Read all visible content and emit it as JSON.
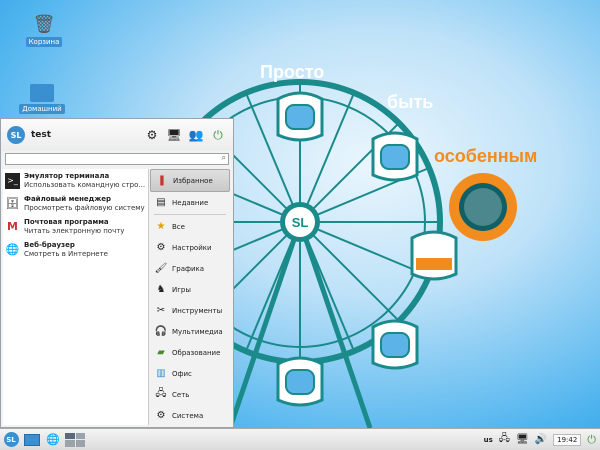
{
  "desktop": {
    "icons": [
      {
        "label": "Корзина",
        "icon": "trash-icon"
      },
      {
        "label": "Домашний",
        "icon": "home-folder-icon"
      }
    ],
    "slogan": {
      "word1": "Просто",
      "word2": "быть",
      "word3": "особенным"
    },
    "wheel_logo": "SL"
  },
  "menu": {
    "logo": "SL",
    "user": "test",
    "header_icons": [
      "search-settings-icon",
      "screen-icon",
      "users-icon",
      "logout-icon"
    ],
    "search": {
      "value": "",
      "placeholder": ""
    },
    "apps": [
      {
        "title": "Эмулятор терминала",
        "desc": "Использовать командную стро...",
        "icon": "terminal-icon"
      },
      {
        "title": "Файловый менеджер",
        "desc": "Просмотреть файловую систему",
        "icon": "file-manager-icon"
      },
      {
        "title": "Почтовая программа",
        "desc": "Читать электронную почту",
        "icon": "mail-icon"
      },
      {
        "title": "Веб-браузер",
        "desc": "Смотреть в Интернете",
        "icon": "globe-icon"
      }
    ],
    "categories": [
      {
        "label": "Избранное",
        "icon": "favorites-icon",
        "selected": true
      },
      {
        "label": "Недавние",
        "icon": "recent-icon"
      },
      {
        "label": "Все",
        "icon": "star-icon"
      },
      {
        "label": "Настройки",
        "icon": "settings-icon"
      },
      {
        "label": "Графика",
        "icon": "graphics-icon"
      },
      {
        "label": "Игры",
        "icon": "games-icon"
      },
      {
        "label": "Инструменты",
        "icon": "tools-icon"
      },
      {
        "label": "Мультимедиа",
        "icon": "headphones-icon"
      },
      {
        "label": "Образование",
        "icon": "education-icon"
      },
      {
        "label": "Офис",
        "icon": "office-icon"
      },
      {
        "label": "Сеть",
        "icon": "network-icon"
      },
      {
        "label": "Система",
        "icon": "system-icon"
      }
    ]
  },
  "taskbar": {
    "start_logo": "SL",
    "layout": "us",
    "time": "19:42"
  },
  "colors": {
    "accent": "#3a8fd0",
    "orange": "#f28c1e",
    "teal": "#1a8a8a"
  }
}
